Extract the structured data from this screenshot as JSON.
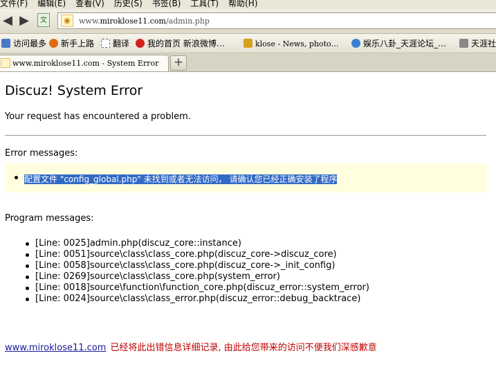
{
  "menu": [
    "文件(F)",
    "编辑(E)",
    "查看(V)",
    "历史(S)",
    "书签(B)",
    "工具(T)",
    "帮助(H)"
  ],
  "address": {
    "prefix": "www.",
    "domain": "miroklose11.com",
    "path": "/admin.php"
  },
  "bookmarks": [
    {
      "label": "访问最多",
      "icon": "gear-icon",
      "color": "#4a78c8"
    },
    {
      "label": "新手上路",
      "icon": "firefox-icon",
      "color": "#e06a10"
    },
    {
      "label": "翻译",
      "icon": "doc-icon",
      "color": "#ffffff"
    },
    {
      "label": "我的首页 新浪微博…",
      "icon": "weibo-icon",
      "color": "#d42020"
    },
    {
      "label": "klose - News, photo…",
      "icon": "site-icon",
      "color": "#d8a020"
    },
    {
      "label": "娱乐八卦_天涯论坛_…",
      "icon": "globe-icon",
      "color": "#3a80d0"
    },
    {
      "label": "天涯社",
      "icon": "tianya-icon",
      "color": "#888888"
    }
  ],
  "tab": {
    "title": "www.miroklose11.com - System Error",
    "new_tab": "+"
  },
  "page": {
    "title": "Discuz! System Error",
    "description": "Your request has encountered a problem.",
    "error_label": "Error messages:",
    "error_message": "配置文件 \"config_global.php\" 未找到或者无法访问， 请确认您已经正确安装了程序",
    "program_label": "Program messages:",
    "program_messages": [
      "[Line: 0025]admin.php(discuz_core::instance)",
      "[Line: 0051]source\\class\\class_core.php(discuz_core->discuz_core)",
      "[Line: 0058]source\\class\\class_core.php(discuz_core->_init_config)",
      "[Line: 0269]source\\class\\class_core.php(system_error)",
      "[Line: 0018]source\\function\\function_core.php(discuz_error::system_error)",
      "[Line: 0024]source\\class\\class_error.php(discuz_error::debug_backtrace)"
    ],
    "footer_link": "www.miroklose11.com",
    "footer_note": "已经将此出错信息详细记录, 由此给您带来的访问不便我们深感歉意"
  }
}
